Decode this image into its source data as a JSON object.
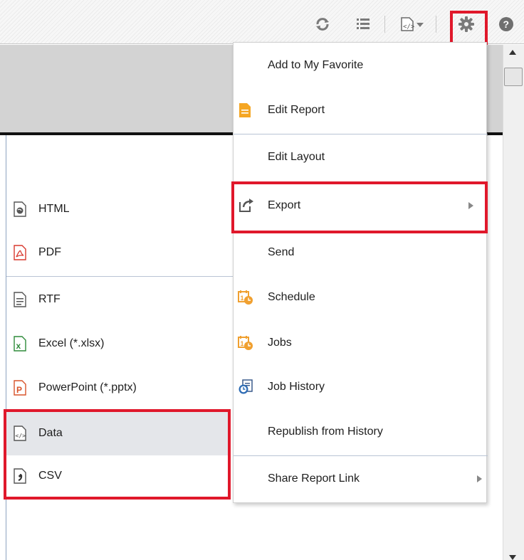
{
  "menu": {
    "items": [
      {
        "label": "Add to My Favorite"
      },
      {
        "label": "Edit Report"
      },
      {
        "label": "Edit Layout"
      },
      {
        "label": "Export"
      },
      {
        "label": "Send"
      },
      {
        "label": "Schedule"
      },
      {
        "label": "Jobs"
      },
      {
        "label": "Job History"
      },
      {
        "label": "Republish from History"
      },
      {
        "label": "Share Report Link"
      }
    ]
  },
  "export_submenu": {
    "items": [
      {
        "label": "HTML"
      },
      {
        "label": "PDF"
      },
      {
        "label": "RTF"
      },
      {
        "label": "Excel (*.xlsx)"
      },
      {
        "label": "PowerPoint (*.pptx)"
      },
      {
        "label": "Data"
      },
      {
        "label": "CSV"
      }
    ]
  },
  "colors": {
    "highlight": "#e0182b",
    "schedule_orange": "#f0a030",
    "pdf_red": "#d8382e",
    "excel_green": "#2e8b3a",
    "ppt_orange": "#d8532a",
    "selected_row": "#e4e6ea"
  },
  "icons": {
    "toolbar": [
      "refresh-icon",
      "list-icon",
      "export-data-icon",
      "gear-icon",
      "help-icon"
    ]
  }
}
